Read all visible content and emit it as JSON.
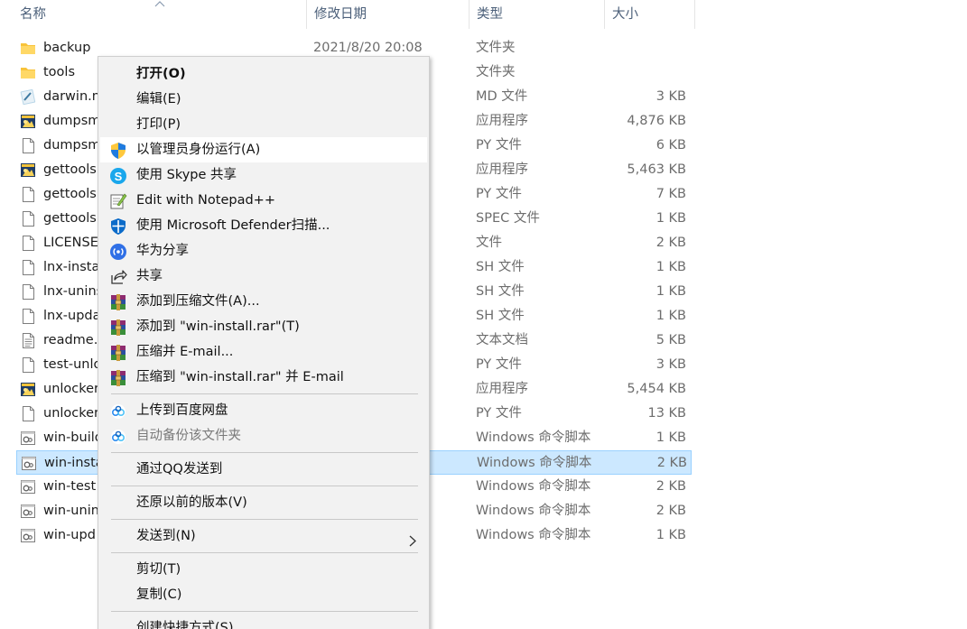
{
  "columns": {
    "name": "名称",
    "date": "修改日期",
    "type": "类型",
    "size": "大小"
  },
  "files": [
    {
      "name": "backup",
      "date": "2021/8/20 20:08",
      "type": "文件夹",
      "size": "",
      "icon": "folder-icon"
    },
    {
      "name": "tools",
      "date": "",
      "type": "文件夹",
      "size": "",
      "icon": "folder-icon"
    },
    {
      "name": "darwin.m",
      "date": "",
      "type": "MD 文件",
      "size": "3 KB",
      "icon": "markdown-file-icon"
    },
    {
      "name": "dumpsm",
      "date": "",
      "type": "应用程序",
      "size": "4,876 KB",
      "icon": "application-icon"
    },
    {
      "name": "dumpsm",
      "date": "",
      "type": "PY 文件",
      "size": "6 KB",
      "icon": "file-icon"
    },
    {
      "name": "gettools",
      "date": "",
      "type": "应用程序",
      "size": "5,463 KB",
      "icon": "application-icon"
    },
    {
      "name": "gettools",
      "date": "",
      "type": "PY 文件",
      "size": "7 KB",
      "icon": "file-icon"
    },
    {
      "name": "gettools",
      "date": "",
      "type": "SPEC 文件",
      "size": "1 KB",
      "icon": "file-icon"
    },
    {
      "name": "LICENSE",
      "date": "",
      "type": "文件",
      "size": "2 KB",
      "icon": "file-icon"
    },
    {
      "name": "lnx-insta",
      "date": "",
      "type": "SH 文件",
      "size": "1 KB",
      "icon": "file-icon"
    },
    {
      "name": "lnx-unins",
      "date": "",
      "type": "SH 文件",
      "size": "1 KB",
      "icon": "file-icon"
    },
    {
      "name": "lnx-upda",
      "date": "",
      "type": "SH 文件",
      "size": "1 KB",
      "icon": "file-icon"
    },
    {
      "name": "readme.",
      "date": "",
      "type": "文本文档",
      "size": "5 KB",
      "icon": "text-file-icon"
    },
    {
      "name": "test-unlo",
      "date": "",
      "type": "PY 文件",
      "size": "3 KB",
      "icon": "file-icon"
    },
    {
      "name": "unlocker",
      "date": "",
      "type": "应用程序",
      "size": "5,454 KB",
      "icon": "application-icon"
    },
    {
      "name": "unlocker",
      "date": "",
      "type": "PY 文件",
      "size": "13 KB",
      "icon": "file-icon"
    },
    {
      "name": "win-build",
      "date": "",
      "type": "Windows 命令脚本",
      "size": "1 KB",
      "icon": "script-file-icon"
    },
    {
      "name": "win-insta",
      "date": "",
      "type": "Windows 命令脚本",
      "size": "2 KB",
      "icon": "script-file-icon",
      "selected": true
    },
    {
      "name": "win-test",
      "date": "",
      "type": "Windows 命令脚本",
      "size": "2 KB",
      "icon": "script-file-icon"
    },
    {
      "name": "win-unin",
      "date": "",
      "type": "Windows 命令脚本",
      "size": "2 KB",
      "icon": "script-file-icon"
    },
    {
      "name": "win-upd",
      "date": "",
      "type": "Windows 命令脚本",
      "size": "1 KB",
      "icon": "script-file-icon"
    }
  ],
  "context_menu": {
    "items": [
      {
        "label": "打开(O)",
        "icon": "",
        "bold": true
      },
      {
        "label": "编辑(E)",
        "icon": ""
      },
      {
        "label": "打印(P)",
        "icon": ""
      },
      {
        "label": "以管理员身份运行(A)",
        "icon": "uac-shield-icon",
        "hover": true
      },
      {
        "label": "使用 Skype 共享",
        "icon": "skype-icon"
      },
      {
        "label": "Edit with Notepad++",
        "icon": "notepad-plus-plus-icon"
      },
      {
        "label": "使用 Microsoft Defender扫描...",
        "icon": "defender-shield-icon"
      },
      {
        "label": "华为分享",
        "icon": "huawei-share-icon"
      },
      {
        "label": "共享",
        "icon": "share-icon"
      },
      {
        "label": "添加到压缩文件(A)...",
        "icon": "winrar-icon"
      },
      {
        "label": "添加到 \"win-install.rar\"(T)",
        "icon": "winrar-icon"
      },
      {
        "label": "压缩并 E-mail...",
        "icon": "winrar-icon"
      },
      {
        "label": "压缩到 \"win-install.rar\" 并 E-mail",
        "icon": "winrar-icon"
      },
      {
        "label": "上传到百度网盘",
        "icon": "baidu-netdisk-icon"
      },
      {
        "label": "自动备份该文件夹",
        "icon": "baidu-netdisk-icon",
        "disabled": true
      },
      {
        "label": "通过QQ发送到",
        "icon": ""
      },
      {
        "label": "还原以前的版本(V)",
        "icon": ""
      },
      {
        "label": "发送到(N)",
        "icon": "",
        "submenu": true
      },
      {
        "label": "剪切(T)",
        "icon": ""
      },
      {
        "label": "复制(C)",
        "icon": ""
      },
      {
        "label": "创建快捷方式(S)",
        "icon": ""
      }
    ]
  },
  "colors": {
    "selection_bg": "#cce8ff",
    "selection_border": "#99d1ff",
    "header_text": "#4c607a",
    "menu_bg": "#f2f2f2"
  }
}
